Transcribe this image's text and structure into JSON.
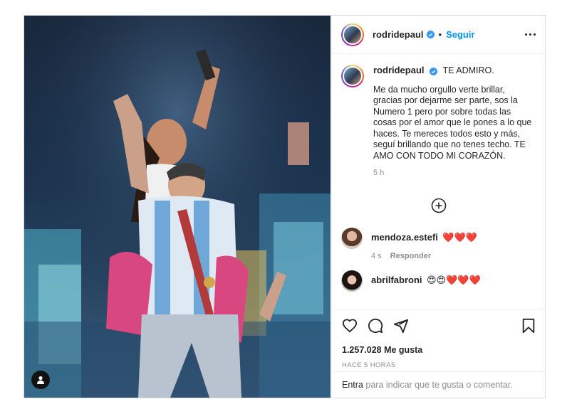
{
  "header": {
    "username": "rodridepaul",
    "follow_label": "Seguir"
  },
  "caption": {
    "username": "rodridepaul",
    "headline": "TE ADMIRO.",
    "text": "Me da mucho orgullo verte brillar, gracias por dejarme ser parte, sos la Numero 1 pero por sobre todas las cosas por el amor que le pones a lo que haces. Te mereces todos esto y más, seguí brillando que no tenes techo. TE AMO CON TODO MI CORAZÓN.",
    "time": "5 h"
  },
  "comments": [
    {
      "username": "mendoza.estefi",
      "emoji": "❤️❤️❤️",
      "time": "4 s",
      "reply_label": "Responder"
    },
    {
      "username": "abrilfabroni",
      "emoji": "😍😍❤️❤️❤️"
    }
  ],
  "actions": {
    "likes": "1.257.028 Me gusta",
    "posted": "HACE 5 HORAS"
  },
  "add_comment": {
    "enter_label": "Entra",
    "text": " para indicar que te gusta o comentar."
  },
  "colors": {
    "accent": "#0095f6",
    "verified": "#3897f0",
    "heart": "#e0245e",
    "muted": "#8e8e8e"
  }
}
